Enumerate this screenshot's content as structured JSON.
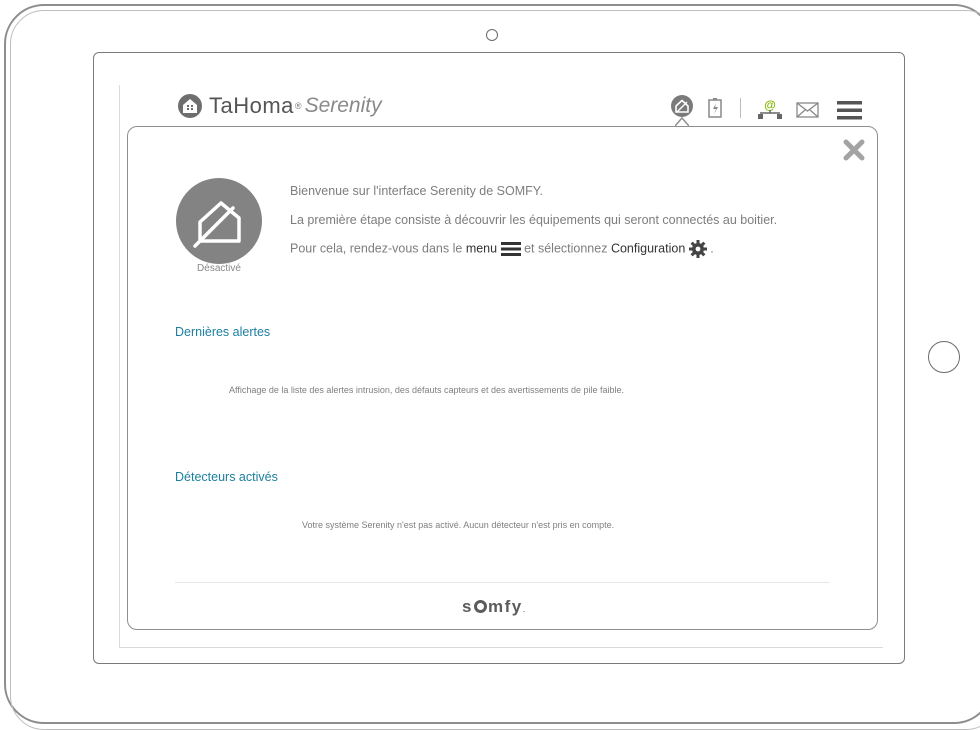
{
  "header": {
    "brand": "TaHoma",
    "brand_mark": "®",
    "brand_sub": "Serenity",
    "icons": [
      "house-alarm-icon",
      "battery-icon",
      "internet-connection-icon",
      "mail-icon",
      "menu-icon"
    ]
  },
  "status": {
    "label": "Désactivé",
    "icon": "house-disarmed-icon"
  },
  "welcome": {
    "line1": "Bienvenue sur l'interface Serenity de SOMFY.",
    "line2": "La première étape consiste à découvrir les équipements qui seront connectés au boitier.",
    "line3_prefix": "Pour cela, rendez-vous dans le",
    "line3_menu": "menu",
    "line3_middle": "et sélectionnez",
    "line3_config": "Configuration",
    "line3_suffix": "."
  },
  "alerts": {
    "title": "Dernières alertes",
    "text": "Affichage de la liste des alertes intrusion, des défauts capteurs et des avertissements de pile faible."
  },
  "detectors": {
    "title": "Détecteurs activés",
    "text": "Votre système Serenity n'est pas activé. Aucun détecteur n'est pris en compte."
  },
  "footer": {
    "logo_before": "s",
    "logo_after": "mfy",
    "logo_dot": "."
  },
  "colors": {
    "accent": "#1b7fa0",
    "status_gray": "#838383",
    "internet_green": "#7fb800"
  }
}
